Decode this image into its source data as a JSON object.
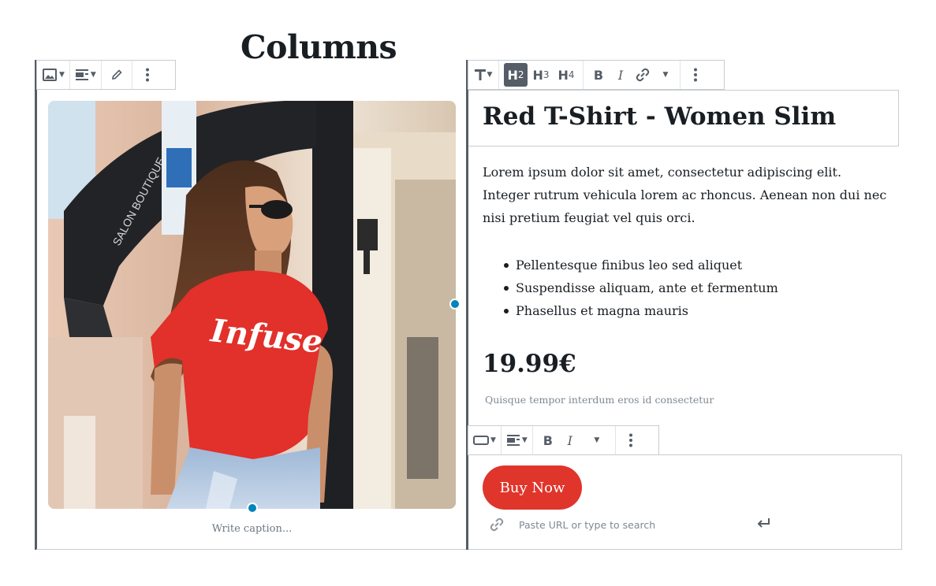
{
  "page": {
    "title": "Columns"
  },
  "image_toolbar": {
    "image_icon": "image-icon",
    "align_icon": "align-icon",
    "edit_icon": "pencil-icon",
    "more_icon": "more-vertical-icon"
  },
  "heading_toolbar": {
    "block_icon": "text-T-icon",
    "levels": [
      {
        "label": "H",
        "sub": "2",
        "active": true
      },
      {
        "label": "H",
        "sub": "3",
        "active": false
      },
      {
        "label": "H",
        "sub": "4",
        "active": false
      }
    ],
    "bold": "B",
    "italic": "I",
    "link_icon": "link-icon",
    "more_icon": "more-vertical-icon"
  },
  "image_block": {
    "shirt_text": "Infuse",
    "sign_text": "SALON BOUTIQUE",
    "caption_placeholder": "Write caption..."
  },
  "product": {
    "heading": "Red T-Shirt - Women Slim",
    "paragraph": "Lorem ipsum dolor sit amet, consectetur adipiscing elit. Integer rutrum  vehicula lorem ac rhoncus. Aenean non dui nec nisi pretium feugiat vel  quis orci.",
    "bullets": [
      "Pellentesque finibus leo sed aliquet",
      "Suspendisse aliquam, ante et fermentum",
      " Phasellus et magna mauris"
    ],
    "price": "19.99€",
    "subtext": "Quisque tempor interdum eros id consectetur"
  },
  "button_toolbar": {
    "block_icon": "button-icon",
    "align_icon": "align-icon",
    "bold": "B",
    "italic": "I",
    "more_icon": "more-vertical-icon"
  },
  "button_block": {
    "label": "Buy Now",
    "url_placeholder": "Paste URL or type to search",
    "color": "#e0352b"
  },
  "colors": {
    "accent_handle": "#0085ba",
    "toolbar_active": "#555d66"
  }
}
